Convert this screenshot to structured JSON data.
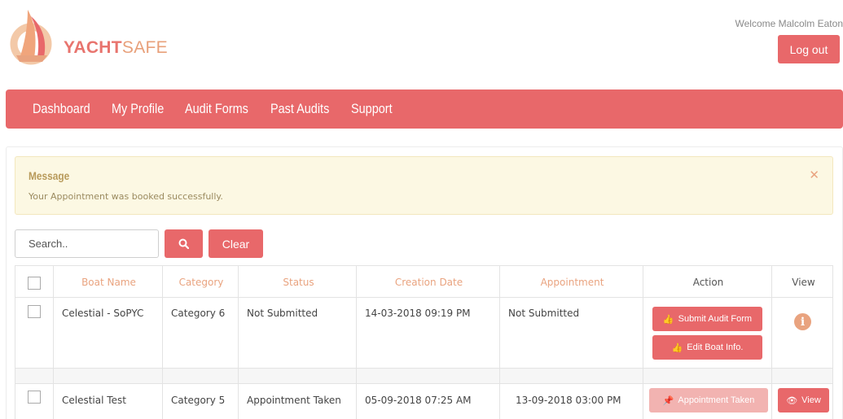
{
  "header": {
    "logo_bold": "YACHT",
    "logo_light": "SAFE",
    "welcome_text": "Welcome Malcolm Eaton",
    "logout_label": "Log out"
  },
  "nav": {
    "items": [
      "Dashboard",
      "My Profile",
      "Audit Forms",
      "Past Audits",
      "Support"
    ]
  },
  "message": {
    "title": "Message",
    "text": "Your Appointment was booked successfully.",
    "close_icon": "close-icon"
  },
  "search": {
    "placeholder": "Search..",
    "button_icon": "search-icon",
    "clear_label": "Clear"
  },
  "table": {
    "columns": [
      "Boat Name",
      "Category",
      "Status",
      "Creation Date",
      "Appointment",
      "Action",
      "View"
    ],
    "rows": [
      {
        "boat_name": "Celestial - SoPYC",
        "category": "Category 6",
        "status": "Not Submitted",
        "creation_date": "14-03-2018 09:19 PM",
        "appointment": "Not Submitted",
        "actions": [
          "Submit Audit Form",
          "Edit Boat Info."
        ],
        "view_icon": "info-icon"
      },
      {
        "boat_name": "Celestial Test",
        "category": "Category 5",
        "status": "Appointment Taken",
        "creation_date": "05-09-2018 07:25 AM",
        "appointment": "13-09-2018 03:00 PM",
        "actions": [
          "Appointment Taken"
        ],
        "view_label": "View"
      }
    ]
  },
  "colors": {
    "accent": "#e8686a",
    "header_text": "#e9a37f",
    "alert_bg": "#fcf8e3"
  }
}
